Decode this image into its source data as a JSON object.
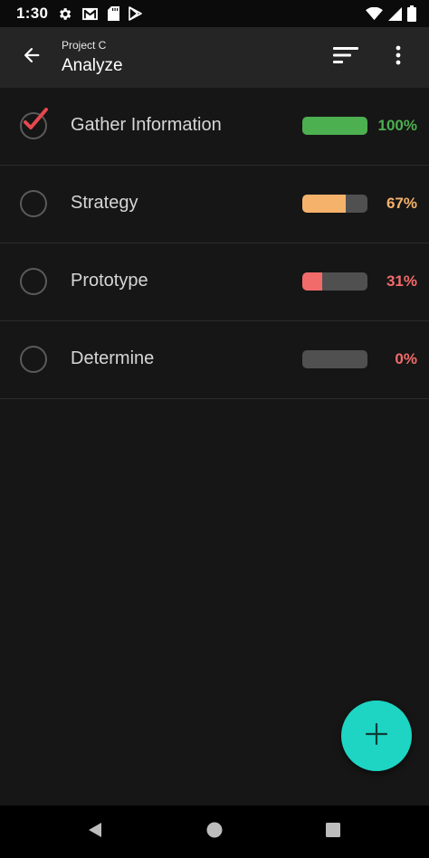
{
  "status_bar": {
    "time": "1:30",
    "icons_left": [
      "gear-icon",
      "gmail-icon",
      "sd-card-icon",
      "play-store-icon"
    ],
    "icons_right": [
      "wifi-icon",
      "signal-icon",
      "battery-icon"
    ]
  },
  "app_bar": {
    "subtitle": "Project C",
    "title": "Analyze",
    "back_icon": "arrow-back-icon",
    "sort_icon": "sort-icon",
    "more_icon": "more-vert-icon"
  },
  "tasks": [
    {
      "label": "Gather Information",
      "checked": true,
      "progress": 100,
      "percent_text": "100%",
      "color": "#4caf50"
    },
    {
      "label": "Strategy",
      "checked": false,
      "progress": 67,
      "percent_text": "67%",
      "color": "#f5b26b"
    },
    {
      "label": "Prototype",
      "checked": false,
      "progress": 31,
      "percent_text": "31%",
      "color": "#f26b6b"
    },
    {
      "label": "Determine",
      "checked": false,
      "progress": 0,
      "percent_text": "0%",
      "color": "#f26b6b"
    }
  ],
  "fab": {
    "icon": "plus-icon",
    "color": "#1ed5c4"
  },
  "nav_bar": {
    "icons": [
      "back-triangle-icon",
      "home-circle-icon",
      "recents-square-icon"
    ]
  },
  "colors": {
    "background": "#161616",
    "app_bar": "#252525",
    "check_red": "#e5484d",
    "track": "#505050"
  }
}
